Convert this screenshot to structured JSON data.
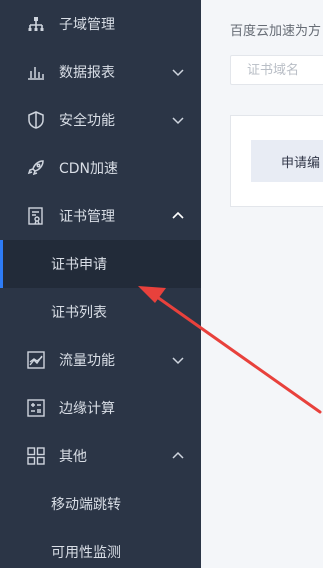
{
  "sidebar": {
    "items": [
      {
        "label": "子域管理",
        "icon": "sitemap-icon"
      },
      {
        "label": "数据报表",
        "icon": "bar-chart-icon"
      },
      {
        "label": "安全功能",
        "icon": "shield-icon"
      },
      {
        "label": "CDN加速",
        "icon": "rocket-icon"
      },
      {
        "label": "证书管理",
        "icon": "certificate-icon"
      },
      {
        "label": "流量功能",
        "icon": "line-chart-icon"
      },
      {
        "label": "边缘计算",
        "icon": "calculator-icon"
      },
      {
        "label": "其他",
        "icon": "grid-icon"
      }
    ],
    "cert_sub": [
      {
        "label": "证书申请",
        "active": true
      },
      {
        "label": "证书列表",
        "active": false
      }
    ],
    "other_sub": [
      {
        "label": "移动端跳转"
      },
      {
        "label": "可用性监测"
      }
    ]
  },
  "main": {
    "description": "百度云加速为方",
    "search_placeholder": "证书域名",
    "apply_button": "申请编"
  },
  "colors": {
    "sidebar_bg": "#2b3546",
    "active_bg": "#222b39",
    "accent": "#2e7cf6",
    "annotation_arrow": "#e8413c"
  }
}
